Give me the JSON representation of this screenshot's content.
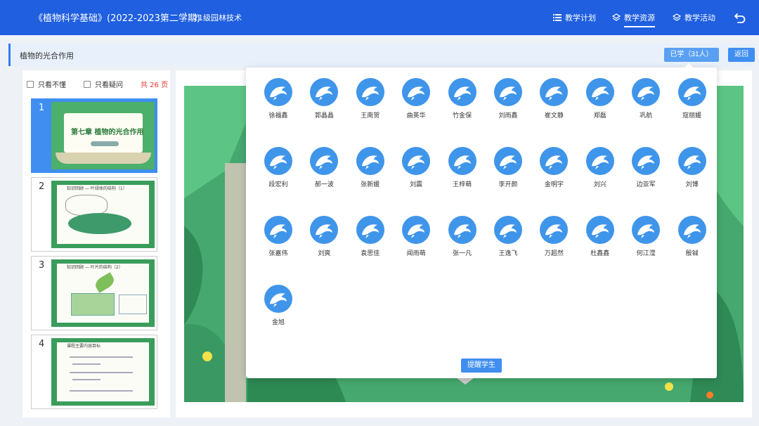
{
  "header": {
    "course_title": "《植物科学基础》(2022-2023第二学期)",
    "class_name": "21级园林技术",
    "nav": [
      {
        "label": "教学计划",
        "icon": "list-icon"
      },
      {
        "label": "教学资源",
        "icon": "layers-icon"
      },
      {
        "label": "教学活动",
        "icon": "layers-icon"
      }
    ],
    "active_nav": "教学资源"
  },
  "subbar": {
    "lesson_title": "植物的光合作用",
    "learned_label": "已学（31人）",
    "return_label": "返回"
  },
  "left": {
    "filter_1": "只看不懂",
    "filter_2": "只看疑问",
    "page_count": "共 26 页",
    "thumbnails": [
      {
        "num": "1",
        "title": "第七章 植物的光合作用"
      },
      {
        "num": "2",
        "title": "知识回顾 — 叶绿体的结构（1）"
      },
      {
        "num": "3",
        "title": "知识回顾 — 叶片的结构（2）"
      },
      {
        "num": "4",
        "title": "课程主要内容目标"
      }
    ]
  },
  "popup": {
    "students": [
      "徐福鑫",
      "郭晶晶",
      "王南贺",
      "曲英华",
      "竹金保",
      "刘雨鑫",
      "崔文静",
      "郑磊",
      "巩航",
      "寇丽媛",
      "段宏利",
      "郝一波",
      "张新媛",
      "刘震",
      "王梓萌",
      "李开颜",
      "金明宇",
      "刘兴",
      "边亚军",
      "刘博",
      "张嘉伟",
      "刘爽",
      "袁思佳",
      "闻雨萌",
      "张一凡",
      "王逸飞",
      "万超然",
      "杜鑫鑫",
      "何江滢",
      "殷铖",
      "金旭"
    ],
    "remind_label": "提醒学生"
  },
  "colors": {
    "header_bg": "#1f5fe0",
    "accent": "#3f8ef0",
    "avatar": "#3f95ea",
    "slide_green": "#3e9f66",
    "count_red": "#e33"
  }
}
